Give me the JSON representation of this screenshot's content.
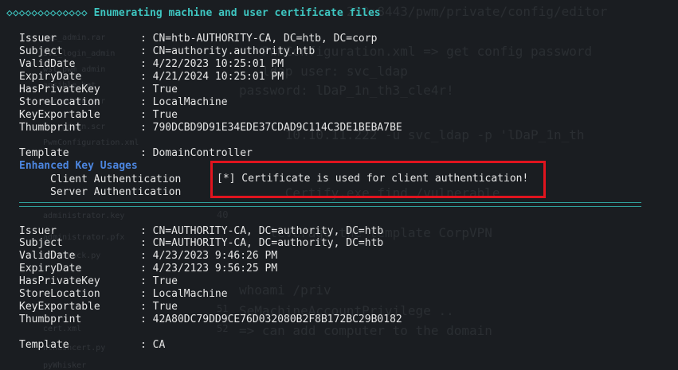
{
  "banner": "◇◇◇◇◇◇◇◇◇◇◇◇◇ Enumerating machine and user certificate files",
  "cert1": {
    "rows": [
      {
        "key": "Issuer",
        "value": "CN=htb-AUTHORITY-CA, DC=htb, DC=corp"
      },
      {
        "key": "Subject",
        "value": "CN=authority.authority.htb"
      },
      {
        "key": "ValidDate",
        "value": "4/22/2023 10:25:01 PM"
      },
      {
        "key": "ExpiryDate",
        "value": "4/21/2024 10:25:01 PM"
      },
      {
        "key": "HasPrivateKey",
        "value": "True"
      },
      {
        "key": "StoreLocation",
        "value": "LocalMachine"
      },
      {
        "key": "KeyExportable",
        "value": "True"
      },
      {
        "key": "Thumbprint",
        "value": "790DCBD9D91E34EDE37CDAD9C114C3DE1BEBA7BE"
      }
    ],
    "template_key": "Template",
    "template_value": "DomainController",
    "eku_heading": "Enhanced Key Usages",
    "eku_items": [
      "Client Authentication",
      "Server Authentication"
    ],
    "highlight": "[*] Certificate is used for client authentication!"
  },
  "cert2": {
    "rows": [
      {
        "key": "Issuer",
        "value": "CN=AUTHORITY-CA, DC=authority, DC=htb"
      },
      {
        "key": "Subject",
        "value": "CN=AUTHORITY-CA, DC=authority, DC=htb"
      },
      {
        "key": "ValidDate",
        "value": "4/23/2023 9:46:26 PM"
      },
      {
        "key": "ExpiryDate",
        "value": "4/23/2123 9:56:25 PM"
      },
      {
        "key": "HasPrivateKey",
        "value": "True"
      },
      {
        "key": "StoreLocation",
        "value": "LocalMachine"
      },
      {
        "key": "KeyExportable",
        "value": "True"
      },
      {
        "key": "Thumbprint",
        "value": "42A80DC79DD9CE76D032080B2F8B172BC29B0182"
      }
    ],
    "template_key": "Template",
    "template_value": "CA"
  },
  "colors": {
    "banner": "#3ec6c1",
    "heading": "#4c86e0",
    "highlight_border": "#e0141e",
    "separator": "#2f9e99",
    "text": "#e6e6e6",
    "background": "#1a1d21"
  }
}
